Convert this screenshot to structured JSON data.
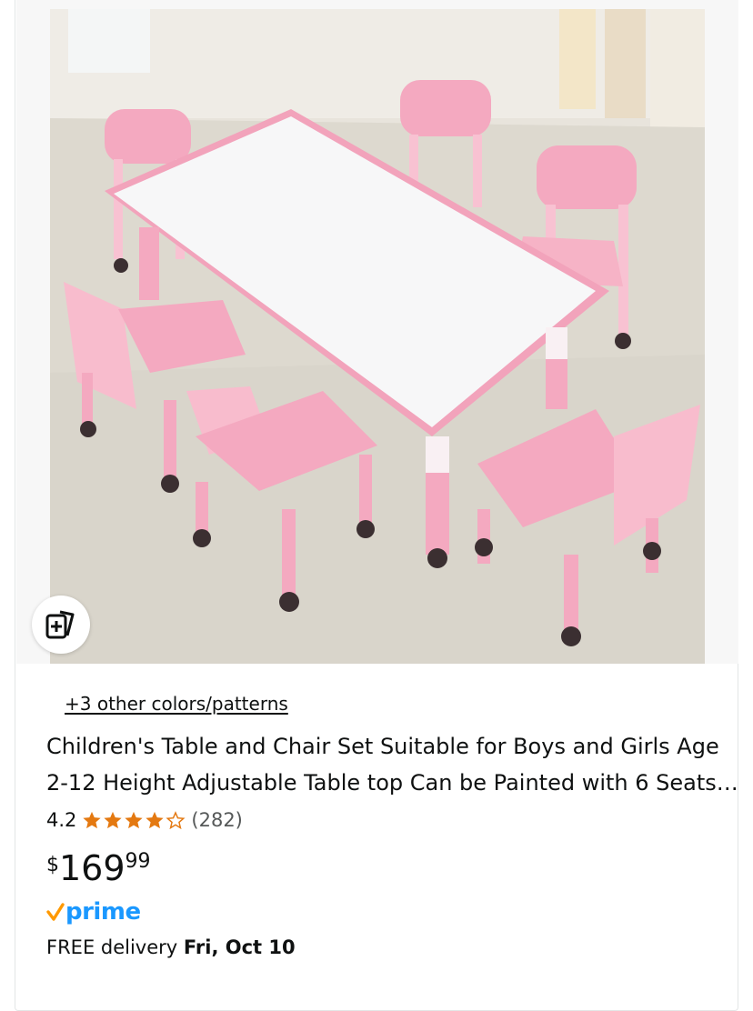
{
  "product": {
    "image_alt": "Pink children's table with six chairs",
    "compare_icon": "add-to-compare-icon",
    "colors_link": "+3 other colors/patterns",
    "title": "Children's Table and Chair Set Suitable for Boys and Girls Age 2-12 Height Adjustable Table top Can be Painted with 6 Seats…",
    "rating": {
      "value": "4.2",
      "stars_filled": 4,
      "stars_total": 5,
      "count": "(282)",
      "star_color": "#e47911"
    },
    "price": {
      "symbol": "$",
      "whole": "169",
      "fraction": "99"
    },
    "prime": {
      "label": "prime",
      "check_icon": "prime-check-icon",
      "color": "#1a98ff",
      "check_color": "#ff9900"
    },
    "delivery": {
      "prefix": "FREE delivery",
      "date": "Fri, Oct 10"
    }
  }
}
